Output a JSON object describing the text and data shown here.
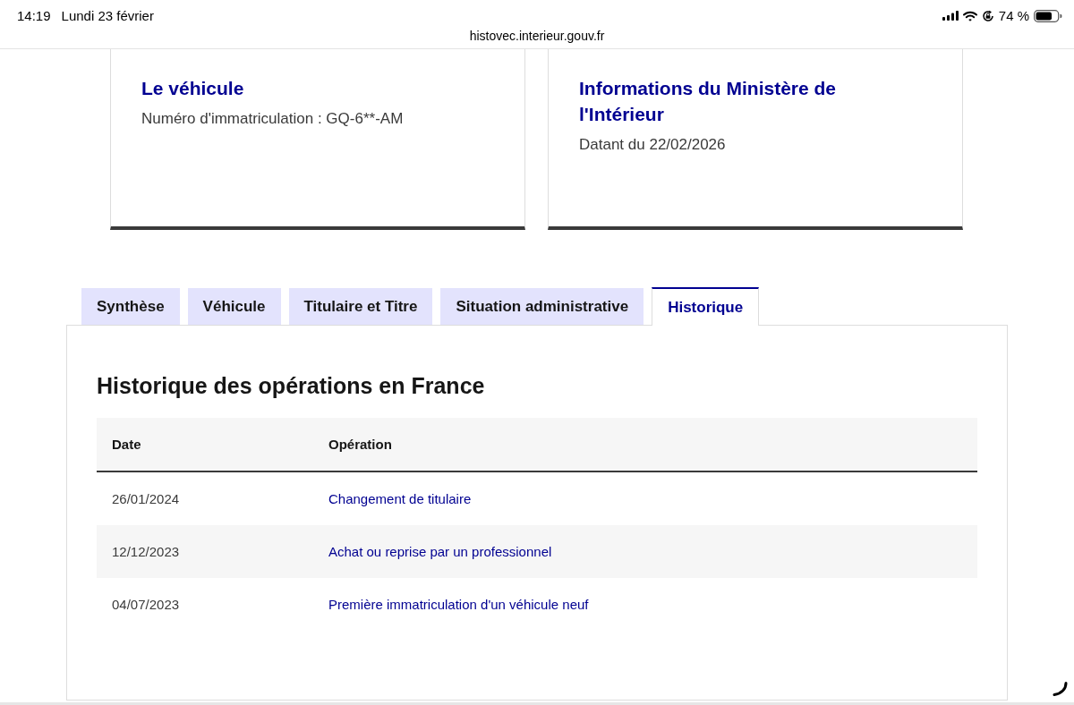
{
  "status_bar": {
    "time": "14:19",
    "date": "Lundi 23 février",
    "battery": "74 %"
  },
  "address_bar": {
    "url": "histovec.interieur.gouv.fr"
  },
  "cards": [
    {
      "title": "Le véhicule",
      "text": "Numéro d'immatriculation : GQ-6**-AM"
    },
    {
      "title": "Informations du Ministère de l'Intérieur",
      "text": "Datant du 22/02/2026"
    }
  ],
  "tabs": [
    {
      "label": "Synthèse",
      "selected": false
    },
    {
      "label": "Véhicule",
      "selected": false
    },
    {
      "label": "Titulaire et Titre",
      "selected": false
    },
    {
      "label": "Situation administrative",
      "selected": false
    },
    {
      "label": "Historique",
      "selected": true
    }
  ],
  "panel": {
    "heading": "Historique des opérations en France",
    "table": {
      "columns": [
        "Date",
        "Opération"
      ],
      "rows": [
        [
          "26/01/2024",
          "Changement de titulaire"
        ],
        [
          "12/12/2023",
          "Achat ou reprise par un professionnel"
        ],
        [
          "04/07/2023",
          "Première immatriculation d'un véhicule neuf"
        ]
      ]
    }
  }
}
